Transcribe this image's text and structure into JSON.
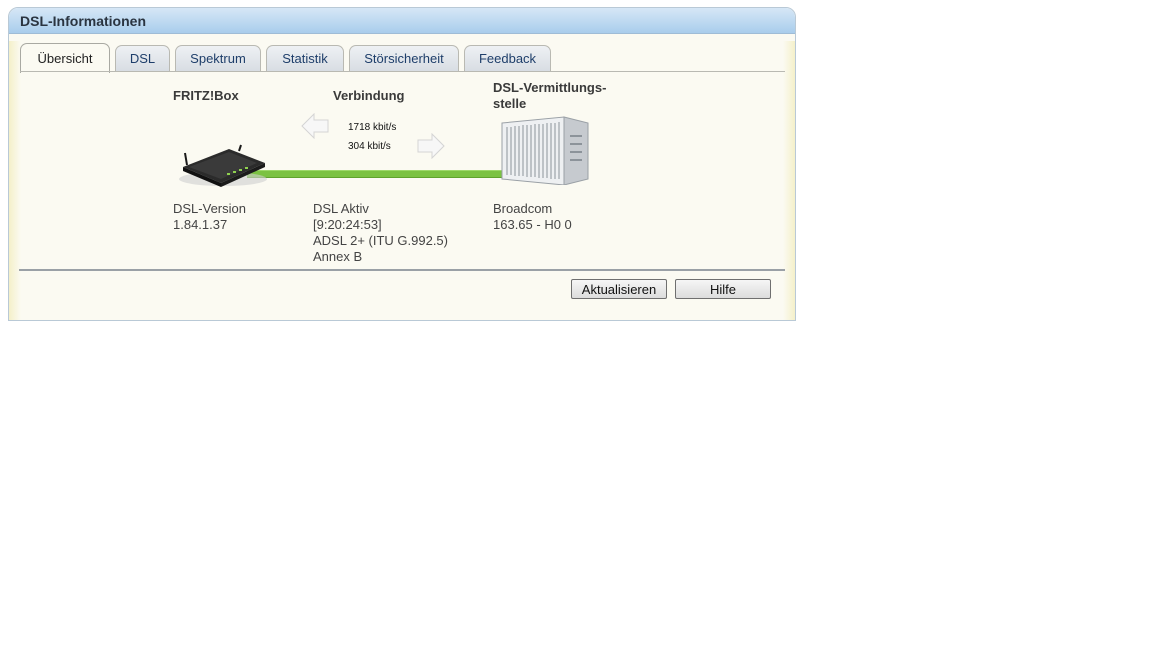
{
  "window": {
    "title": "DSL-Informationen"
  },
  "tabs": [
    {
      "label": "Übersicht",
      "active": true
    },
    {
      "label": "DSL"
    },
    {
      "label": "Spektrum"
    },
    {
      "label": "Statistik"
    },
    {
      "label": "Störsicherheit"
    },
    {
      "label": "Feedback"
    }
  ],
  "overview": {
    "fritzbox": {
      "heading": "FRITZ!Box",
      "lines": [
        "DSL-Version",
        "1.84.1.37"
      ]
    },
    "connection": {
      "heading": "Verbindung",
      "downstream": "1718 kbit/s",
      "upstream": "304 kbit/s",
      "lines": [
        "DSL Aktiv",
        "[9:20:24:53]",
        "ADSL 2+ (ITU G.992.5)",
        "Annex B"
      ]
    },
    "exchange": {
      "heading_line1": "DSL-Vermittlungs-",
      "heading_line2": "stelle",
      "lines": [
        "Broadcom",
        "163.65 - H0 0"
      ]
    }
  },
  "buttons": {
    "refresh": "Aktualisieren",
    "help": "Hilfe"
  },
  "colors": {
    "titlebar": "#a9cdec",
    "line_active": "#7bc242",
    "panel_bg": "#fbfaf2"
  },
  "icons": {
    "router": "router-icon",
    "exchange": "server-rack-icon",
    "downstream": "arrow-left-icon",
    "upstream": "arrow-right-icon"
  }
}
